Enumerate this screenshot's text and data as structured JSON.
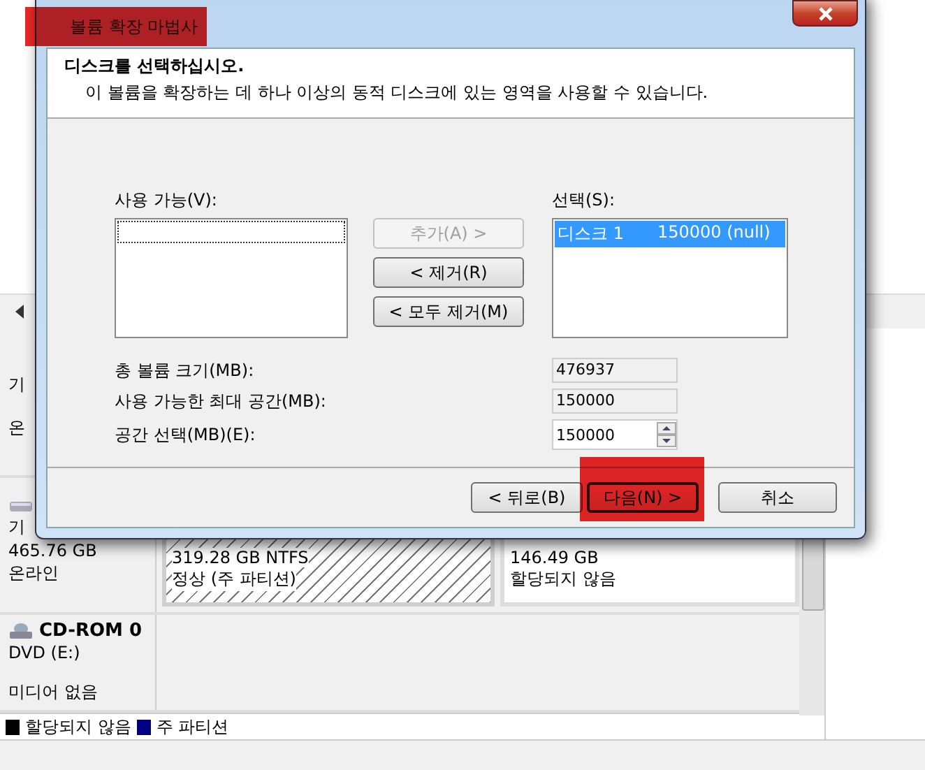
{
  "background_window": {
    "disks": [
      {
        "kind": "disk",
        "label_lines": [
          "기",
          "온"
        ]
      },
      {
        "kind": "disk",
        "label_lines": [
          "기",
          "465.76 GB",
          "온라인"
        ],
        "partitions": [
          {
            "kind": "primary",
            "size": "319.28 GB NTFS",
            "status": "정상 (주 파티션)"
          },
          {
            "kind": "unallocated",
            "size": "146.49 GB",
            "status": "할당되지 않음"
          }
        ]
      },
      {
        "kind": "cdrom",
        "title": "CD-ROM 0",
        "label_lines": [
          "DVD (E:)"
        ],
        "note": "미디어 없음"
      }
    ],
    "legend": [
      {
        "label": "할당되지 않음",
        "color": "#000000"
      },
      {
        "label": "주 파티션",
        "color": "#000080"
      }
    ]
  },
  "dialog": {
    "title": "볼륨 확장 마법사",
    "highlighted": true,
    "header": {
      "title": "디스크를 선택하십시오.",
      "subtitle": "이 볼륨을 확장하는 데 하나 이상의 동적 디스크에 있는 영역을 사용할 수 있습니다."
    },
    "available": {
      "label": "사용 가능(V):"
    },
    "selected_list": {
      "label": "선택(S):",
      "items": [
        {
          "disk": "디스크 1",
          "size": "150000 (null)",
          "selected": true
        }
      ]
    },
    "move_buttons": [
      {
        "label": "추가(A) >",
        "disabled": true
      },
      {
        "label": "< 제거(R)",
        "disabled": false
      },
      {
        "label": "< 모두 제거(M)",
        "disabled": false
      }
    ],
    "fields": [
      {
        "kind": "readonly",
        "label": "총 볼륨 크기(MB):",
        "value": "476937"
      },
      {
        "kind": "readonly",
        "label": "사용 가능한 최대 공간(MB):",
        "value": "150000"
      },
      {
        "kind": "spinner",
        "label": "공간 선택(MB)(E):",
        "value": "150000"
      }
    ],
    "footer_buttons": [
      {
        "label": "< 뒤로(B)",
        "default": false,
        "highlighted": false
      },
      {
        "label": "다음(N) >",
        "default": true,
        "highlighted": true
      },
      {
        "label": "취소",
        "default": false,
        "highlighted": false
      }
    ]
  }
}
